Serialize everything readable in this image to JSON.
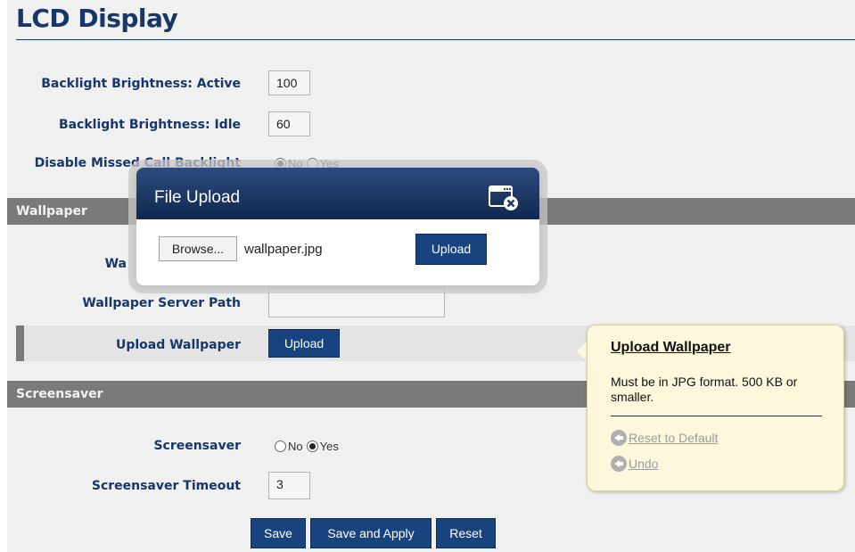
{
  "page": {
    "title": "LCD Display"
  },
  "display": {
    "backlight_active": {
      "label": "Backlight Brightness: Active",
      "value": "100"
    },
    "backlight_idle": {
      "label": "Backlight Brightness: Idle",
      "value": "60"
    },
    "disable_missed_call": {
      "label": "Disable Missed Call Backlight",
      "options": [
        "No",
        "Yes"
      ],
      "selected": "No"
    }
  },
  "wallpaper": {
    "section_title": "Wallpaper",
    "wallpaper_label_partial": "Wa",
    "server_path": {
      "label": "Wallpaper Server Path",
      "value": ""
    },
    "upload": {
      "label": "Upload Wallpaper",
      "button": "Upload"
    }
  },
  "screensaver": {
    "section_title": "Screensaver",
    "screensaver": {
      "label": "Screensaver",
      "options": [
        "No",
        "Yes"
      ],
      "selected": "Yes"
    },
    "timeout": {
      "label": "Screensaver Timeout",
      "value": "3"
    }
  },
  "actions": {
    "save": "Save",
    "save_apply": "Save and Apply",
    "reset": "Reset"
  },
  "modal": {
    "title": "File Upload",
    "browse_label": "Browse...",
    "file_name": "wallpaper.jpg",
    "upload_label": "Upload",
    "close_icon": "close-window-icon"
  },
  "tooltip": {
    "title": "Upload Wallpaper",
    "body": "Must be in JPG format. 500 KB or smaller.",
    "links": [
      "Reset to Default",
      "Undo"
    ]
  },
  "colors": {
    "brand": "#17376a",
    "button": "#17437f",
    "section_bar": "#7a7a7a",
    "tooltip_bg": "#fdf8dc"
  }
}
